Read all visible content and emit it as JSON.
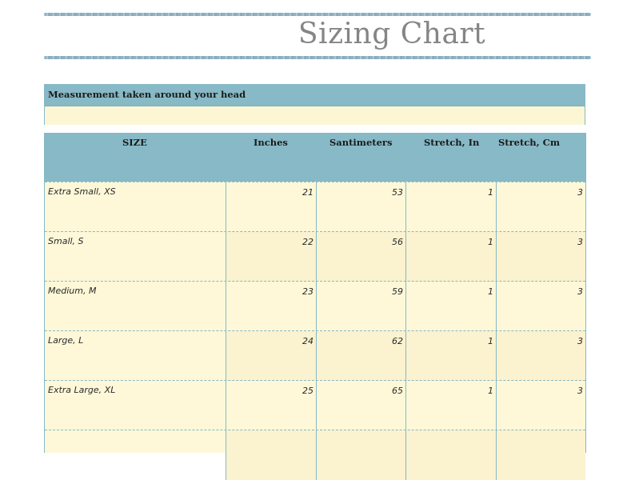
{
  "title": "Sizing Chart",
  "note": {
    "heading": "Measurement taken around your head",
    "body": ""
  },
  "columns": [
    "SIZE",
    "Inches",
    "Santimeters",
    "Stretch, In",
    "Stretch, Cm"
  ],
  "rows": [
    {
      "size": "Extra Small, XS",
      "inches": "21",
      "cm": "53",
      "stretch_in": "1",
      "stretch_cm": "3"
    },
    {
      "size": "Small, S",
      "inches": "22",
      "cm": "56",
      "stretch_in": "1",
      "stretch_cm": "3"
    },
    {
      "size": "Medium, M",
      "inches": "23",
      "cm": "59",
      "stretch_in": "1",
      "stretch_cm": "3"
    },
    {
      "size": "Large, L",
      "inches": "24",
      "cm": "62",
      "stretch_in": "1",
      "stretch_cm": "3"
    },
    {
      "size": "Extra Large, XL",
      "inches": "25",
      "cm": "65",
      "stretch_in": "1",
      "stretch_cm": "3"
    }
  ],
  "colors": {
    "header_blue": "#87b9c6",
    "cell_cream": "#fef8d8",
    "title_gray": "#858585"
  }
}
